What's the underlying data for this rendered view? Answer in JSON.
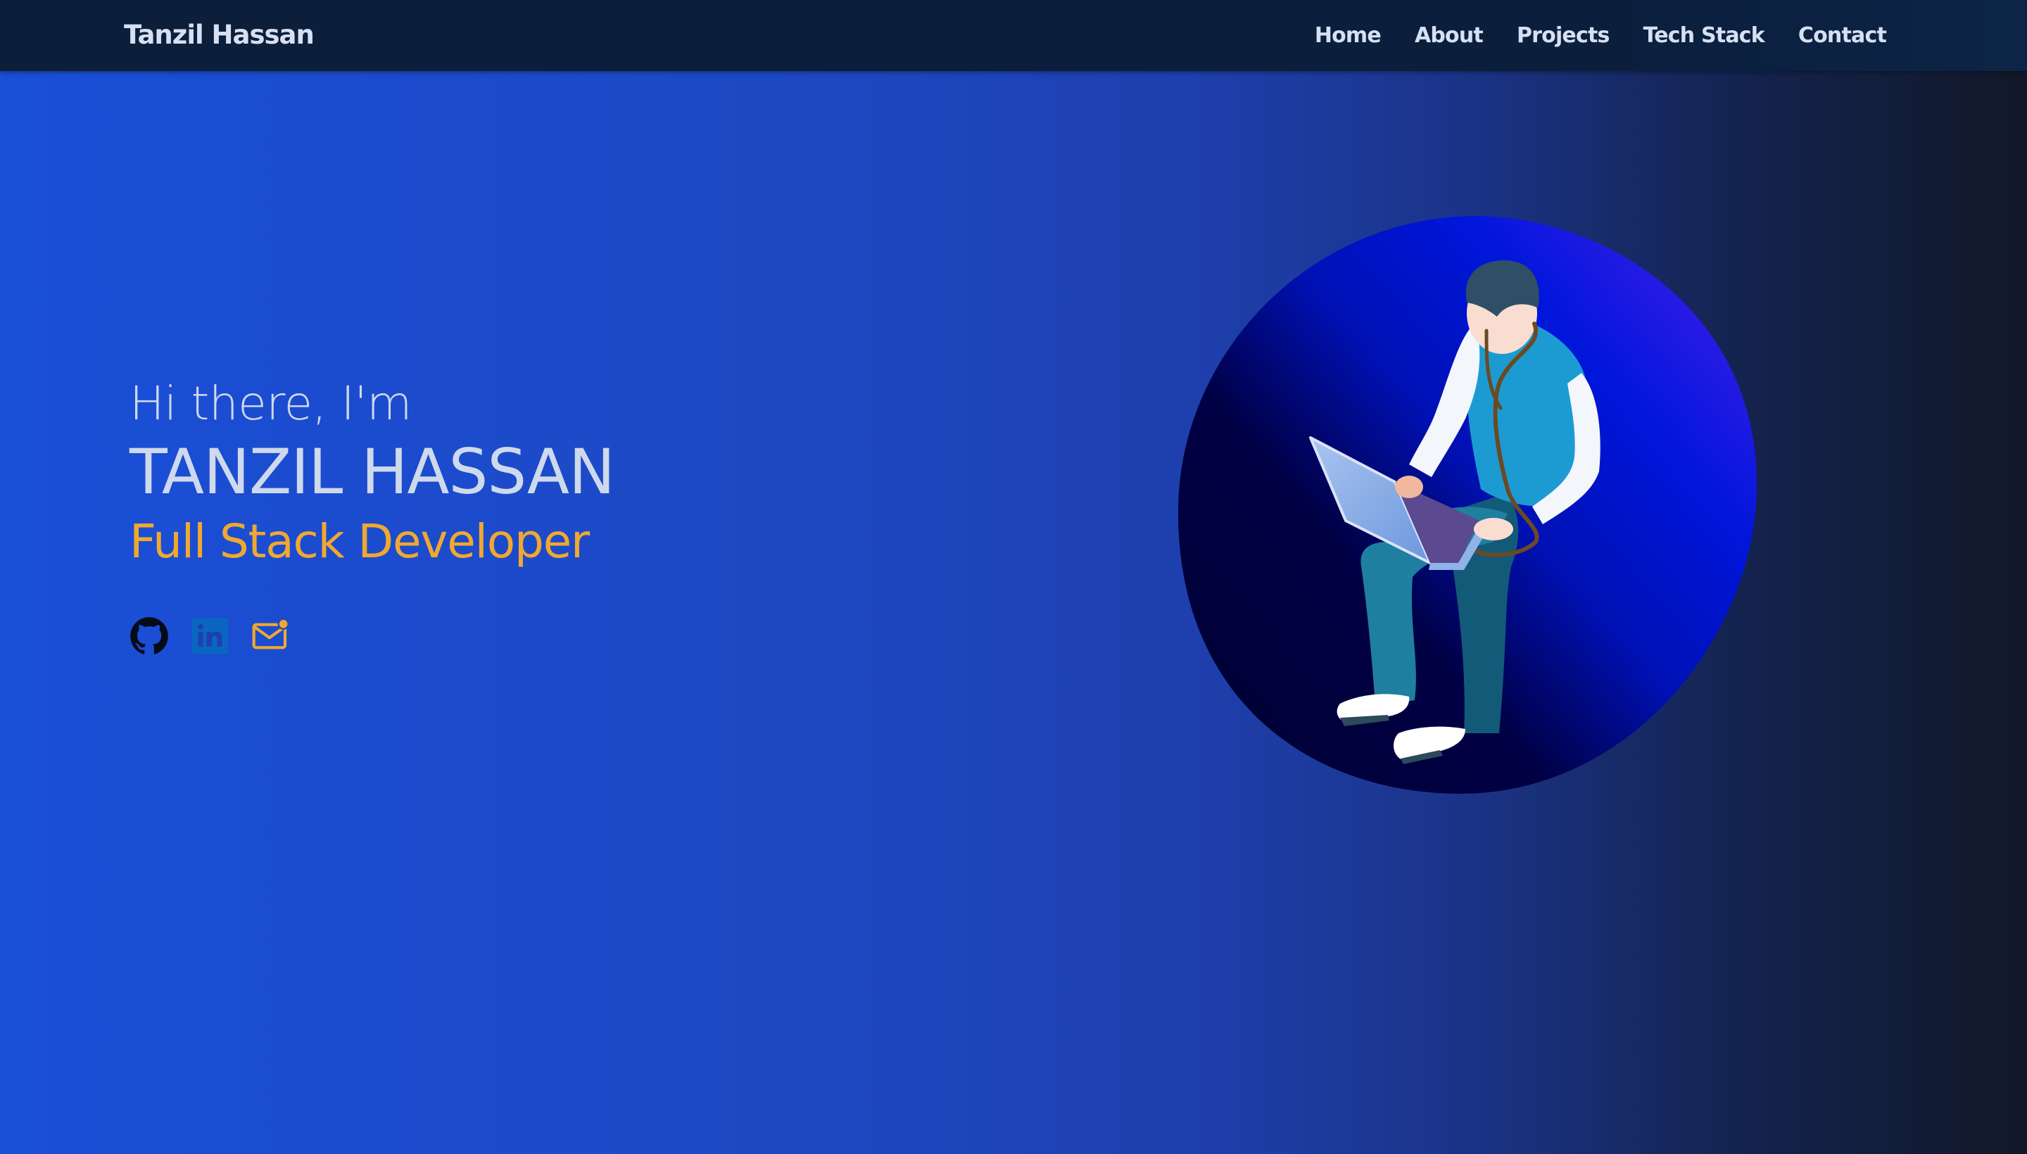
{
  "navbar": {
    "brand": "Tanzil Hassan",
    "links": [
      {
        "label": "Home"
      },
      {
        "label": "About"
      },
      {
        "label": "Projects"
      },
      {
        "label": "Tech Stack"
      },
      {
        "label": "Contact"
      }
    ]
  },
  "hero": {
    "greeting": "Hi there, I'm",
    "name": "TANZIL HASSAN",
    "role": "Full Stack Developer"
  },
  "socials": [
    {
      "icon": "github-icon"
    },
    {
      "icon": "linkedin-icon"
    },
    {
      "icon": "mail-icon"
    }
  ],
  "illustration": {
    "icon": "developer-laptop-illustration"
  },
  "colors": {
    "accent": "#f0a830",
    "text": "#cfd9ec",
    "navbar": "#0b1f3d",
    "gradient_start": "#1a4fd8",
    "gradient_end": "#111827",
    "linkedin": "#0a66c2"
  }
}
